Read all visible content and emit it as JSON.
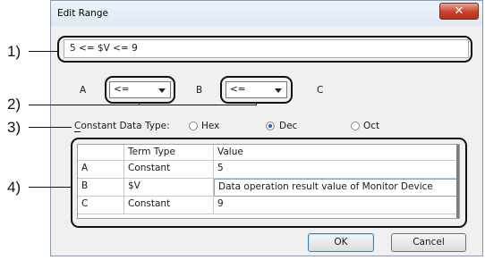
{
  "window": {
    "title": "Edit Range",
    "close_symbol": "✕"
  },
  "expression": {
    "value": "5 <= $V <= 9"
  },
  "operators": {
    "a_label": "A",
    "b_label": "B",
    "c_label": "C",
    "op1_value": "<=",
    "op2_value": "<="
  },
  "data_type": {
    "label": "Constant Data Type:",
    "options": [
      "Hex",
      "Dec",
      "Oct"
    ],
    "selected": "Dec"
  },
  "table": {
    "headers": [
      "",
      "Term Type",
      "Value"
    ],
    "rows": [
      {
        "key": "A",
        "term_type": "Constant",
        "value": "5"
      },
      {
        "key": "B",
        "term_type": "$V",
        "value": "Data operation result value of Monitor Device"
      },
      {
        "key": "C",
        "term_type": "Constant",
        "value": "9"
      }
    ]
  },
  "buttons": {
    "ok": "OK",
    "cancel": "Cancel"
  },
  "callouts": [
    "1)",
    "2)",
    "3)",
    "4)"
  ]
}
